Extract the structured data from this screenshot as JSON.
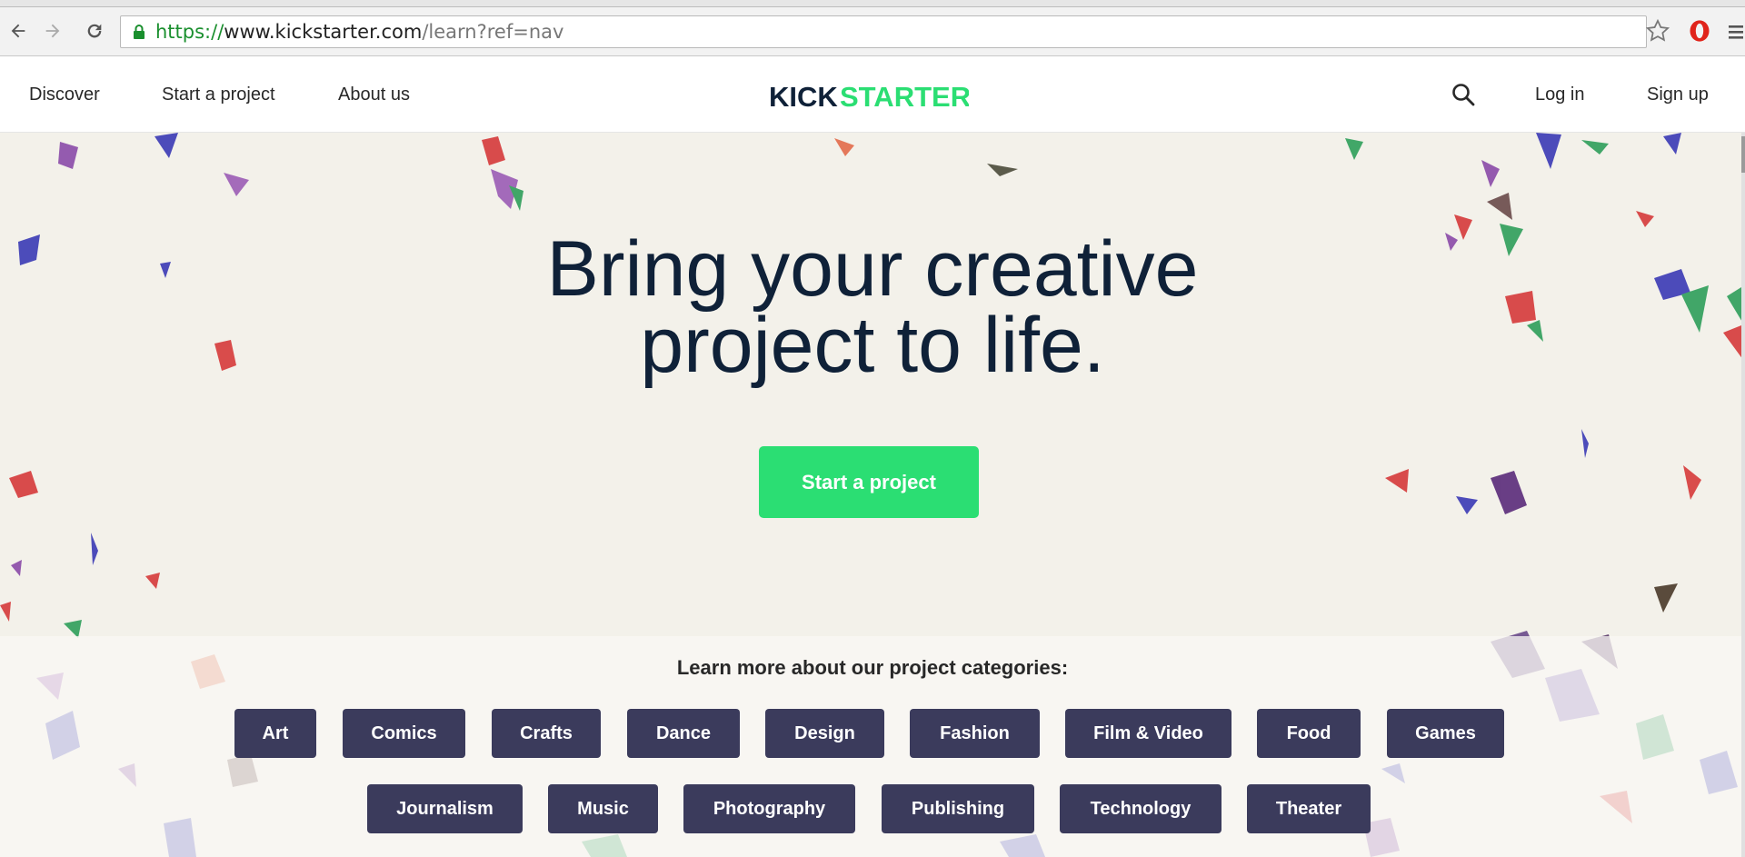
{
  "browser": {
    "url_scheme": "https://",
    "url_host": "www.kickstarter.com",
    "url_path": "/learn?ref=nav",
    "icons": [
      "back-icon",
      "forward-icon",
      "reload-icon",
      "lock-icon",
      "star-icon",
      "opera-icon",
      "menu-icon"
    ]
  },
  "header": {
    "nav": {
      "discover": "Discover",
      "start_project": "Start a project",
      "about_us": "About us",
      "log_in": "Log in",
      "sign_up": "Sign up"
    },
    "logo": {
      "part1": "KICK",
      "part2": "STARTER",
      "color_dark": "#0f2138",
      "color_green": "#2bde73"
    }
  },
  "hero": {
    "headline_line1": "Bring your creative",
    "headline_line2": "project to life.",
    "cta": "Start a project",
    "accent_color": "#2bde73"
  },
  "categories": {
    "heading": "Learn more about our project categories:",
    "row1": [
      "Art",
      "Comics",
      "Crafts",
      "Dance",
      "Design",
      "Fashion",
      "Film & Video",
      "Food",
      "Games"
    ],
    "row2": [
      "Journalism",
      "Music",
      "Photography",
      "Publishing",
      "Technology",
      "Theater"
    ],
    "button_color": "#3b3b5c"
  }
}
